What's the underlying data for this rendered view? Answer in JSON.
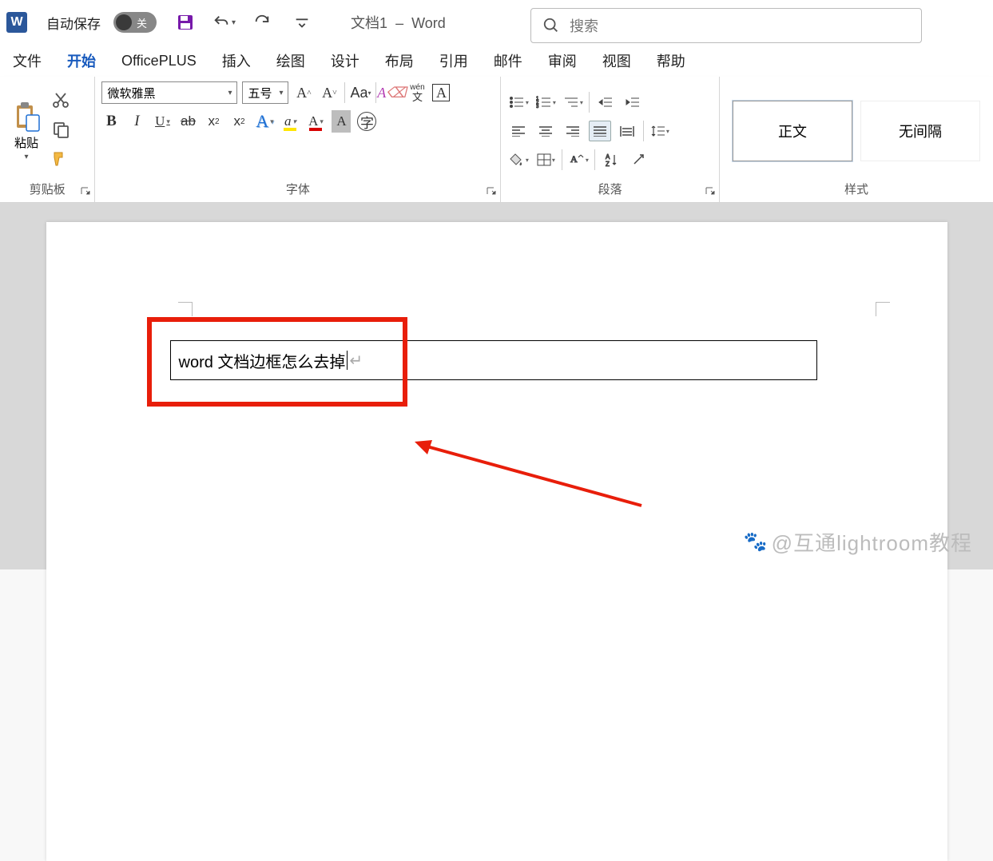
{
  "title": {
    "autosave": "自动保存",
    "toggle_state": "关",
    "doc": "文档1",
    "sep": "–",
    "app": "Word",
    "search_placeholder": "搜索"
  },
  "tabs": [
    "文件",
    "开始",
    "OfficePLUS",
    "插入",
    "绘图",
    "设计",
    "布局",
    "引用",
    "邮件",
    "审阅",
    "视图",
    "帮助"
  ],
  "active_tab": 1,
  "clipboard": {
    "paste": "粘贴",
    "label": "剪贴板"
  },
  "font": {
    "name": "微软雅黑",
    "size": "五号",
    "label": "字体",
    "pinyin": "wén",
    "pinyin_sub": "文"
  },
  "paragraph": {
    "label": "段落"
  },
  "styles": {
    "label": "样式",
    "items": [
      "正文",
      "无间隔"
    ]
  },
  "doc_text": "word 文档边框怎么去掉",
  "watermark": "@互通lightroom教程"
}
